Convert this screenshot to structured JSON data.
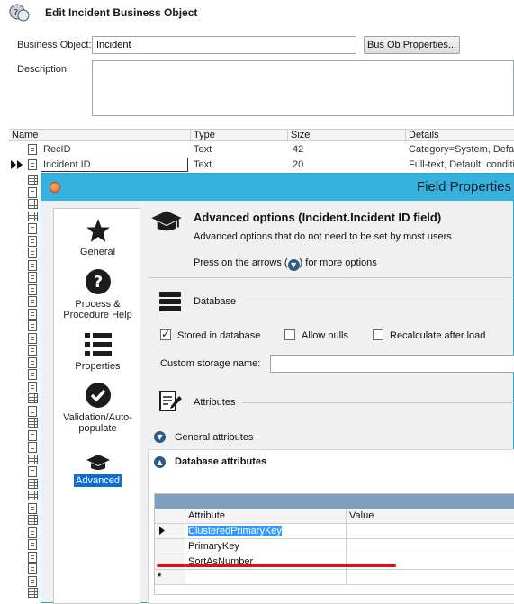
{
  "window": {
    "title": "Edit Incident Business Object"
  },
  "form": {
    "business_object_label": "Business Object:",
    "business_object_value": "Incident",
    "bus_ob_properties_button": "Bus Ob Properties...",
    "description_label": "Description:",
    "description_value": ""
  },
  "grid": {
    "columns": [
      "Name",
      "Type",
      "Size",
      "Details"
    ],
    "rows": [
      {
        "name": "RecID",
        "type": "Text",
        "size": "42",
        "details": "Category=System, Defau"
      },
      {
        "name": "Incident ID",
        "type": "Text",
        "size": "20",
        "details": "Full-text, Default: conditio"
      }
    ]
  },
  "dialog": {
    "title": "Field Properties",
    "nav": [
      {
        "label": "General",
        "icon": "star-icon"
      },
      {
        "label": "Process & Procedure Help",
        "icon": "question-icon"
      },
      {
        "label": "Properties",
        "icon": "list-icon"
      },
      {
        "label": "Validation/Auto-populate",
        "icon": "checkmark-icon"
      },
      {
        "label": "Advanced",
        "icon": "graduation-cap-icon"
      }
    ],
    "heading": "Advanced options (Incident.Incident ID field)",
    "subheading": "Advanced options that do not need to be set by most users.",
    "hint_before": "Press on the arrows (",
    "hint_after": ") for more options",
    "database_section": "Database",
    "checkboxes": [
      {
        "label": "Stored in database",
        "checked": true
      },
      {
        "label": "Allow nulls",
        "checked": false
      },
      {
        "label": "Recalculate after load",
        "checked": false
      }
    ],
    "custom_storage_label": "Custom storage name:",
    "custom_storage_value": "",
    "attributes_section": "Attributes",
    "general_attributes": "General attributes",
    "database_attributes": "Database attributes",
    "attr_table": {
      "columns": [
        "Attribute",
        "Value"
      ],
      "rows": [
        {
          "attribute": "ClusteredPrimaryKey",
          "value": ""
        },
        {
          "attribute": "PrimaryKey",
          "value": ""
        },
        {
          "attribute": "SortAsNumber",
          "value": ""
        }
      ],
      "new_row_marker": "*"
    }
  },
  "colors": {
    "dialog_title_bar": "#36b0dd",
    "selection_blue": "#0b6ed8",
    "annotation_red": "#e01010"
  }
}
